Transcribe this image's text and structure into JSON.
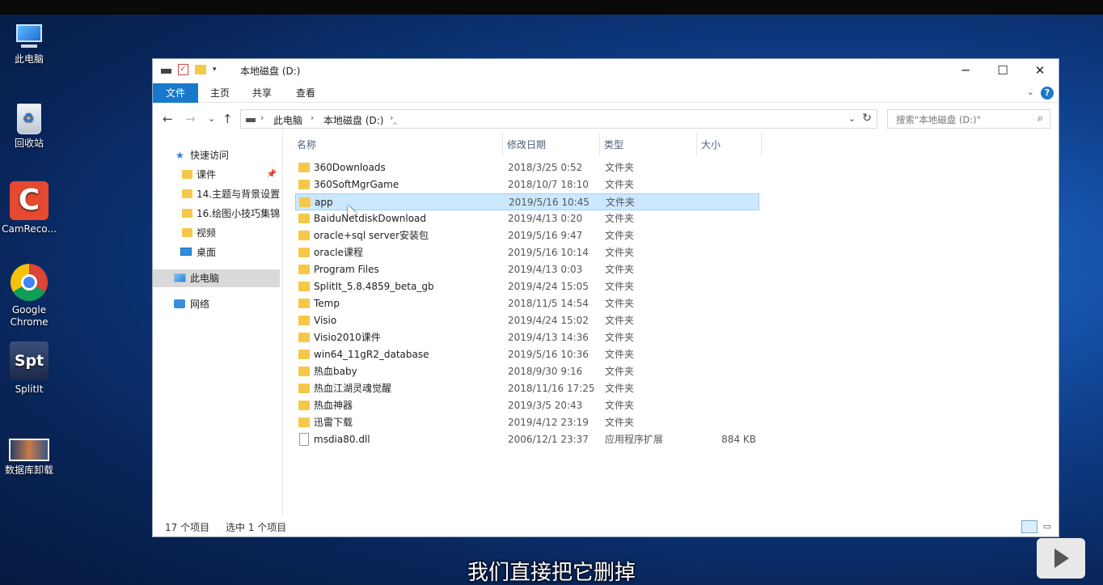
{
  "desktop": {
    "icons": [
      {
        "label": "此电脑",
        "icon": "this-pc-icon"
      },
      {
        "label": "回收站",
        "icon": "recycle-bin-icon"
      },
      {
        "label": "CamReco...",
        "icon": "camrecorder-icon",
        "glyph": "C"
      },
      {
        "label": "Google\nChrome",
        "icon": "chrome-icon"
      },
      {
        "label": "SplitIt",
        "icon": "splitit-icon",
        "glyph": "Spt"
      },
      {
        "label": "数据库卸载",
        "icon": "database-uninstall-icon"
      }
    ]
  },
  "window": {
    "title": "本地磁盘 (D:)",
    "controls": {
      "minimize": "─",
      "maximize": "☐",
      "close": "✕"
    },
    "ribbon_tabs": [
      "文件",
      "主页",
      "共享",
      "查看"
    ],
    "help": "?",
    "nav": {
      "back": "←",
      "forward": "→",
      "recent": "⌄",
      "up": "↑"
    },
    "address": {
      "crumbs": [
        "此电脑",
        "本地磁盘 (D:)"
      ],
      "separator": "›"
    },
    "search_placeholder": "搜索\"本地磁盘 (D:)\"",
    "sidebar": [
      {
        "label": "快速访问",
        "icon": "star-icon",
        "level": 0
      },
      {
        "label": "课件",
        "icon": "folder-icon",
        "level": 1,
        "pinned": true
      },
      {
        "label": "14.主题与背景设置",
        "icon": "folder-icon",
        "level": 1
      },
      {
        "label": "16.绘图小技巧集锦",
        "icon": "folder-icon",
        "level": 1
      },
      {
        "label": "视频",
        "icon": "folder-icon",
        "level": 1
      },
      {
        "label": "桌面",
        "icon": "desktop-icon",
        "level": 1
      },
      {
        "label": "此电脑",
        "icon": "this-pc-icon",
        "level": 0,
        "selected": true
      },
      {
        "label": "网络",
        "icon": "network-icon",
        "level": 0
      }
    ],
    "columns": [
      "名称",
      "修改日期",
      "类型",
      "大小"
    ],
    "files": [
      {
        "name": "360Downloads",
        "date": "2018/3/25 0:52",
        "type": "文件夹",
        "size": ""
      },
      {
        "name": "360SoftMgrGame",
        "date": "2018/10/7 18:10",
        "type": "文件夹",
        "size": ""
      },
      {
        "name": "app",
        "date": "2019/5/16 10:45",
        "type": "文件夹",
        "size": "",
        "selected": true
      },
      {
        "name": "BaiduNetdiskDownload",
        "date": "2019/4/13 0:20",
        "type": "文件夹",
        "size": ""
      },
      {
        "name": "oracle+sql server安装包",
        "date": "2019/5/16 9:47",
        "type": "文件夹",
        "size": ""
      },
      {
        "name": "oracle课程",
        "date": "2019/5/16 10:14",
        "type": "文件夹",
        "size": ""
      },
      {
        "name": "Program Files",
        "date": "2019/4/13 0:03",
        "type": "文件夹",
        "size": ""
      },
      {
        "name": "SplitIt_5.8.4859_beta_gb",
        "date": "2019/4/24 15:05",
        "type": "文件夹",
        "size": ""
      },
      {
        "name": "Temp",
        "date": "2018/11/5 14:54",
        "type": "文件夹",
        "size": ""
      },
      {
        "name": "Visio",
        "date": "2019/4/24 15:02",
        "type": "文件夹",
        "size": ""
      },
      {
        "name": "Visio2010课件",
        "date": "2019/4/13 14:36",
        "type": "文件夹",
        "size": ""
      },
      {
        "name": "win64_11gR2_database",
        "date": "2019/5/16 10:36",
        "type": "文件夹",
        "size": ""
      },
      {
        "name": "热血baby",
        "date": "2018/9/30 9:16",
        "type": "文件夹",
        "size": ""
      },
      {
        "name": "热血江湖灵魂觉醒",
        "date": "2018/11/16 17:25",
        "type": "文件夹",
        "size": ""
      },
      {
        "name": "热血神器",
        "date": "2019/3/5 20:43",
        "type": "文件夹",
        "size": ""
      },
      {
        "name": "迅雷下载",
        "date": "2019/4/12 23:19",
        "type": "文件夹",
        "size": ""
      },
      {
        "name": "msdia80.dll",
        "date": "2006/12/1 23:37",
        "type": "应用程序扩展",
        "size": "884 KB",
        "is_file": true
      }
    ],
    "status": {
      "count": "17 个项目",
      "selected": "选中 1 个项目"
    }
  },
  "subtitle": "我们直接把它删掉"
}
